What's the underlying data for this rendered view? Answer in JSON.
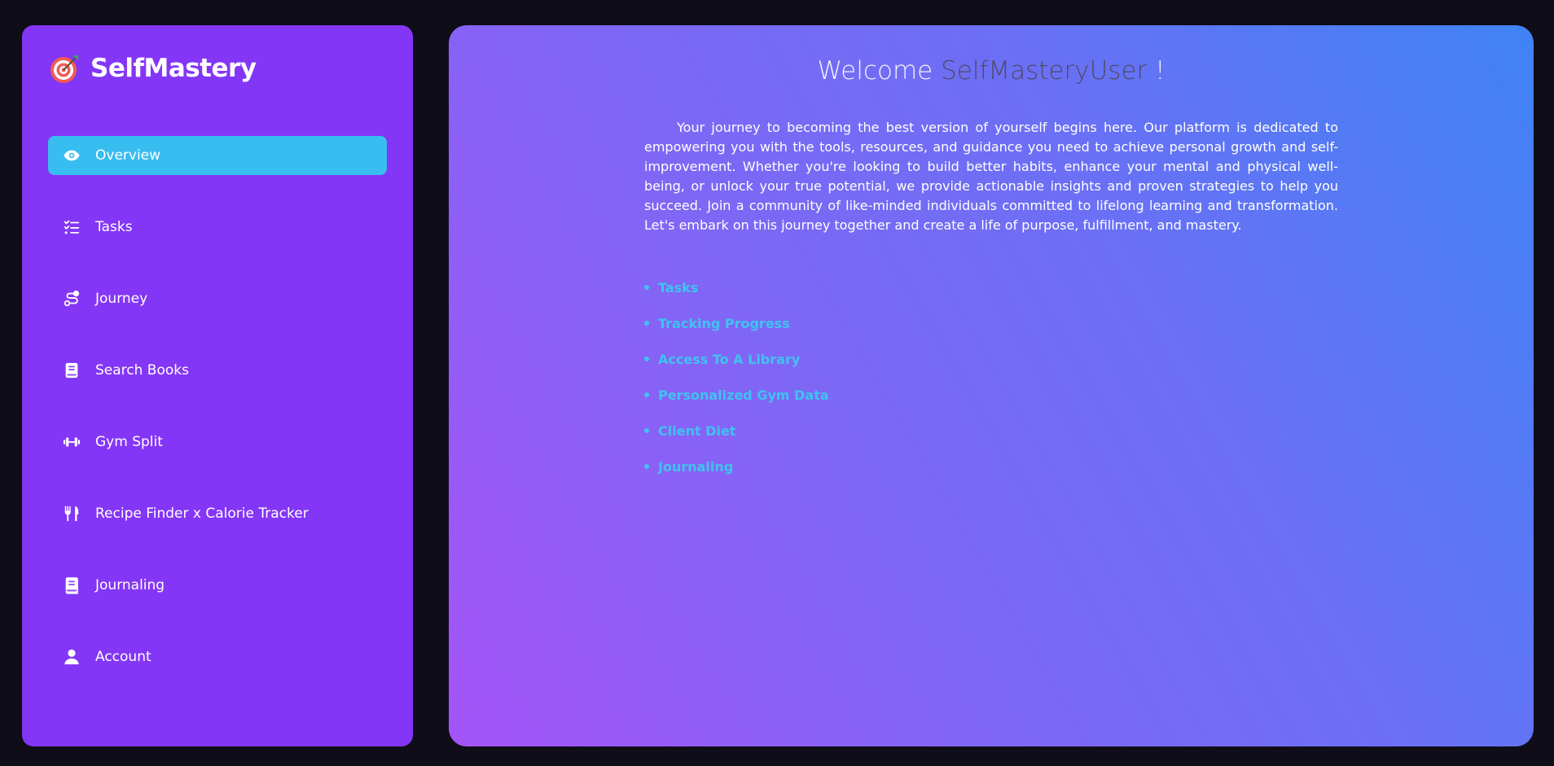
{
  "brand": {
    "name": "SelfMastery",
    "icon": "target-icon"
  },
  "sidebar": {
    "items": [
      {
        "label": "Overview",
        "icon": "eye-icon",
        "active": true
      },
      {
        "label": "Tasks",
        "icon": "checklist-icon",
        "active": false
      },
      {
        "label": "Journey",
        "icon": "route-icon",
        "active": false
      },
      {
        "label": "Search Books",
        "icon": "book-icon",
        "active": false
      },
      {
        "label": "Gym Split",
        "icon": "dumbbell-icon",
        "active": false
      },
      {
        "label": "Recipe Finder x Calorie Tracker",
        "icon": "utensils-icon",
        "active": false
      },
      {
        "label": "Journaling",
        "icon": "journal-icon",
        "active": false
      },
      {
        "label": "Account",
        "icon": "user-icon",
        "active": false
      }
    ]
  },
  "main": {
    "welcome_prefix": "Welcome",
    "username": "SelfMasteryUser",
    "welcome_suffix": "!",
    "intro": "Your journey to becoming the best version of yourself begins here. Our platform is dedicated to empowering you with the tools, resources, and guidance you need to achieve personal growth and self-improvement. Whether you're looking to build better habits, enhance your mental and physical well-being, or unlock your true potential, we provide actionable insights and proven strategies to help you succeed. Join a community of like-minded individuals committed to lifelong learning and transformation. Let's embark on this journey together and create a life of purpose, fulfillment, and mastery.",
    "features": [
      "Tasks",
      "Tracking Progress",
      "Access To A Library",
      "Personalized Gym Data",
      "Client Diet",
      "Journaling"
    ]
  },
  "colors": {
    "background": "#0f0d17",
    "sidebar": "#8436f6",
    "active_item": "#38bdf0",
    "feature_text": "#3fc3ef",
    "username": "#504a63"
  }
}
